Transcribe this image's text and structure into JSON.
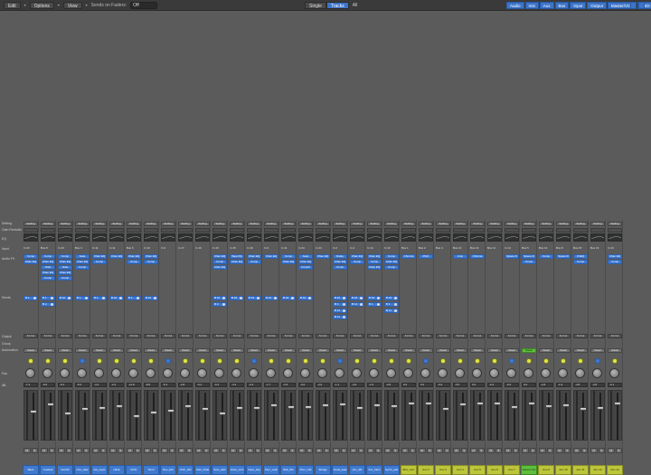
{
  "toolbar": {
    "edit": "Edit",
    "options": "Options",
    "view": "View",
    "sends_label": "Sends on Faders:",
    "sends_value": "Off",
    "view_modes": [
      "Single",
      "Tracks",
      "All"
    ],
    "filters": [
      "Audio",
      "Inst",
      "Aux",
      "Bus",
      "Input",
      "Output",
      "Master/VCA",
      "MIDI"
    ]
  },
  "row_labels": {
    "setting": "Setting",
    "gain": "Gain Reduction",
    "eq": "EQ",
    "input": "Input",
    "audio_fx": "Audio FX",
    "sends": "Sends",
    "output": "Output",
    "group": "Group",
    "automation": "Automation",
    "pan": "Pan",
    "db": "dB"
  },
  "strips": [
    {
      "input": "In 23",
      "fx": [
        "Comp",
        "Chan EQ"
      ],
      "sends": [
        "B 1"
      ],
      "output": "St Out",
      "auto": "Read",
      "db": "-7.4",
      "name": "Bass",
      "color": "blue"
    },
    {
      "input": "Bus 8",
      "fx": [
        "Comp",
        "Chan EQ",
        "Gate",
        "Chan EQ",
        "Comp"
      ],
      "sends": [
        "B 1",
        "B 2"
      ],
      "output": "St Out",
      "auto": "Read",
      "db": "-0.6",
      "name": "Cowbell",
      "color": "blue"
    },
    {
      "input": "In 23",
      "fx": [
        "Comp",
        "Chan EQ",
        "Gate",
        "Chan EQ",
        "Comp"
      ],
      "sends": [
        "B 10"
      ],
      "output": "St Out",
      "auto": "Read",
      "db": "-9.4",
      "name": "Gurr02",
      "color": "blue"
    },
    {
      "input": "Bus 3",
      "fx": [
        "Gate",
        "Chan EQ",
        "Comp"
      ],
      "sends": [
        "B 1"
      ],
      "output": "St Out",
      "auto": "Read",
      "db": "-5.0",
      "name": "Cho_Haw",
      "color": "blue"
    },
    {
      "input": "In 11",
      "fx": [
        "Chan EQ",
        "Comp"
      ],
      "sends": [
        "B 1"
      ],
      "output": "St Out",
      "auto": "Read",
      "db": "-4.4",
      "name": "Gui_reper",
      "color": "blue"
    },
    {
      "input": "In 11",
      "fx": [
        "Chan EQ"
      ],
      "sends": [
        "B 10"
      ],
      "output": "St Out",
      "auto": "Read",
      "db": "-2.2",
      "name": "Hihat",
      "color": "blue"
    },
    {
      "input": "Bus 6",
      "fx": [
        "Chan EQ",
        "Comp"
      ],
      "sends": [
        "B 1"
      ],
      "output": "St Out",
      "auto": "Read",
      "db": "-11.8",
      "name": "KICK",
      "color": "blue"
    },
    {
      "input": "In 10",
      "fx": [
        "Chan EQ",
        "Comp"
      ],
      "sends": [
        "B 10"
      ],
      "output": "St Out",
      "auto": "Read",
      "db": "-8.6",
      "name": "Tom2",
      "color": "blue"
    },
    {
      "input": "In 9",
      "fx": [],
      "sends": [],
      "output": "St Out",
      "auto": "Read",
      "db": "-6.4",
      "name": "Rev_Hth",
      "color": "blue"
    },
    {
      "input": "In 17",
      "fx": [],
      "sends": [],
      "output": "St Out",
      "auto": "Read",
      "db": "-2.8",
      "name": "Orch_Hth",
      "color": "blue"
    },
    {
      "input": "In 16",
      "fx": [],
      "sends": [],
      "output": "St Out",
      "auto": "Read",
      "db": "-5.4",
      "name": "Solo_hihat",
      "color": "blue"
    },
    {
      "input": "In 16",
      "fx": [
        "Chan EQ",
        "Comp",
        "Chan EQ"
      ],
      "sends": [
        "B 16",
        "B 3"
      ],
      "output": "St Out",
      "auto": "Read",
      "db": "-9.4",
      "name": "Solo_tuttri",
      "color": "blue"
    },
    {
      "input": "In 15",
      "fx": [
        "Tape Dly",
        "Chan EQ"
      ],
      "sends": [
        "B 16"
      ],
      "output": "St Out",
      "auto": "Read",
      "db": "-4.4",
      "name": "Voice_nrch",
      "color": "blue"
    },
    {
      "input": "In 16",
      "fx": [
        "Chan EQ",
        "Comp"
      ],
      "sends": [
        "B 16"
      ],
      "output": "St Out",
      "auto": "Read",
      "db": "-4.4",
      "name": "Voice_bup",
      "color": "blue"
    },
    {
      "input": "In 6",
      "fx": [
        "Chan EQ"
      ],
      "sends": [
        "B 10"
      ],
      "output": "St Out",
      "auto": "Read",
      "db": "-1.7",
      "name": "Perc_main",
      "color": "blue"
    },
    {
      "input": "In 11",
      "fx": [
        "Comp",
        "Chan EQ"
      ],
      "sends": [
        "B 16"
      ],
      "output": "St Out",
      "auto": "Read",
      "db": "-3.2",
      "name": "Bell_Hth",
      "color": "blue"
    },
    {
      "input": "In 24",
      "fx": [
        "Gate",
        "Chan EQ",
        "Comp2"
      ],
      "sends": [
        "B 16"
      ],
      "output": "St Out",
      "auto": "Read",
      "db": "-3.6",
      "name": "Perc_odb",
      "color": "blue"
    },
    {
      "input": "In 24",
      "fx": [
        "Chan EQ"
      ],
      "sends": [],
      "output": "St Out",
      "auto": "Read",
      "db": "-2.0",
      "name": "Strings",
      "color": "blue"
    },
    {
      "input": "In 2",
      "fx": [
        "Delay",
        "Chan EQ",
        "Comp"
      ],
      "sends": [
        "B 16",
        "B 1",
        "B 14",
        "B 11"
      ],
      "output": "St Out",
      "auto": "Read",
      "db": "-1.1",
      "name": "Vocal_lead",
      "color": "blue"
    },
    {
      "input": "In 4",
      "fx": [
        "Chan EQ",
        "Comp"
      ],
      "sends": [
        "B 16",
        "B 14"
      ],
      "output": "St Out",
      "auto": "Read",
      "db": "-4.0",
      "name": "Vox_dbl",
      "color": "blue"
    },
    {
      "input": "In 14",
      "fx": [
        "Chan EQ",
        "Comp",
        "Chan EQ"
      ],
      "sends": [
        "B 16",
        "B 1"
      ],
      "output": "St Out",
      "auto": "Read",
      "db": "-1.5",
      "name": "Vox_harm",
      "color": "blue"
    },
    {
      "input": "In 13",
      "fx": [
        "Comp",
        "Chan EQ",
        "Comp"
      ],
      "sends": [
        "B 16",
        "B 1",
        "B 11"
      ],
      "output": "St Out",
      "auto": "Read",
      "db": "-2.8",
      "name": "Synth_pad",
      "color": "blue"
    },
    {
      "input": "Bus 1",
      "fx": [
        "Chroma"
      ],
      "sends": [],
      "output": "St Out",
      "auto": "Read",
      "db": "0.0",
      "name": "Bus_verb",
      "color": "yellow"
    },
    {
      "input": "Bus 2",
      "fx": [
        "Pitch"
      ],
      "sends": [],
      "output": "St Out",
      "auto": "Read",
      "db": "0.0",
      "name": "Aux 2",
      "color": "yellow"
    },
    {
      "input": "Bus 4",
      "fx": [],
      "sends": [],
      "output": "St Out",
      "auto": "Read",
      "db": "-5.0",
      "name": "Aux 3",
      "color": "yellow"
    },
    {
      "input": "Bus 10",
      "fx": [
        "Amp"
      ],
      "sends": [],
      "output": "St Out",
      "auto": "Read",
      "db": "-0.5",
      "name": "Aux 4",
      "color": "yellow"
    },
    {
      "input": "Bus 13",
      "fx": [
        "Chroma"
      ],
      "sends": [],
      "output": "St Out",
      "auto": "Read",
      "db": "0.0",
      "name": "Aux 5",
      "color": "yellow"
    },
    {
      "input": "Bus 11",
      "fx": [],
      "sends": [],
      "output": "St Out",
      "auto": "Read",
      "db": "-0.3",
      "name": "Aux 6",
      "color": "yellow"
    },
    {
      "input": "In 14",
      "fx": [
        "Space D"
      ],
      "sends": [],
      "output": "St Out",
      "auto": "Read",
      "db": "-3.0",
      "name": "Aux 7",
      "color": "yellow"
    },
    {
      "input": "Bus 5",
      "fx": [
        "Space D",
        "Comp"
      ],
      "sends": [],
      "output": "St Out",
      "auto": "Read",
      "db": "0.0",
      "name": "Stereo Out",
      "color": "green"
    },
    {
      "input": "Bus 14",
      "fx": [
        "Comp"
      ],
      "sends": [],
      "output": "St Out",
      "auto": "Read",
      "db": "-2.8",
      "name": "Aux 9",
      "color": "yellow"
    },
    {
      "input": "Bus 8",
      "fx": [
        "Space D"
      ],
      "sends": [],
      "output": "St Out",
      "auto": "Read",
      "db": "-1.9",
      "name": "Aux 10",
      "color": "yellow"
    },
    {
      "input": "Bus 15",
      "fx": [
        "ChEQ",
        "Comp"
      ],
      "sends": [],
      "output": "St Out",
      "auto": "Read",
      "db": "-4.8",
      "name": "Aux 11",
      "color": "yellow"
    },
    {
      "input": "Bus 16",
      "fx": [],
      "sends": [],
      "output": "St Out",
      "auto": "Read",
      "db": "-3.8",
      "name": "Aux 12",
      "color": "yellow"
    },
    {
      "input": "In 24",
      "fx": [
        "Chan EQ",
        "Comp"
      ],
      "sends": [],
      "output": "St Out",
      "auto": "Read",
      "db": "-0.1",
      "name": "Aux 14",
      "color": "yellow"
    }
  ]
}
